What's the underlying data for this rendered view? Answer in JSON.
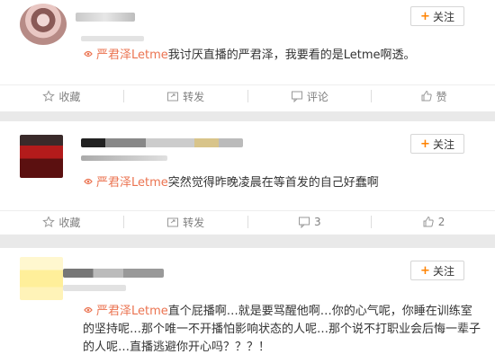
{
  "follow_label": "关注",
  "posts": [
    {
      "tag": "严君泽Letme",
      "text": "我讨厌直播的严君泽，我要看的是Letme啊透。",
      "actions": {
        "collect": "收藏",
        "repost": "转发",
        "comment": "评论",
        "like": "赞"
      }
    },
    {
      "tag": "严君泽Letme",
      "text": "突然觉得昨晚凌晨在等首发的自己好蠢啊",
      "actions": {
        "collect": "收藏",
        "repost": "转发",
        "comment": "3",
        "like": "2"
      }
    },
    {
      "tag": "严君泽Letme",
      "text": "直个屁播啊…就是要骂醒他啊…你的心气呢，你睡在训练室的坚持呢…那个唯一不开播怕影响状态的人呢…那个说不打职业会后悔一辈子的人呢…直播逃避你开心吗？？？！"
    }
  ],
  "colors": {
    "accent": "#ff8200",
    "tag": "#eb7350"
  }
}
